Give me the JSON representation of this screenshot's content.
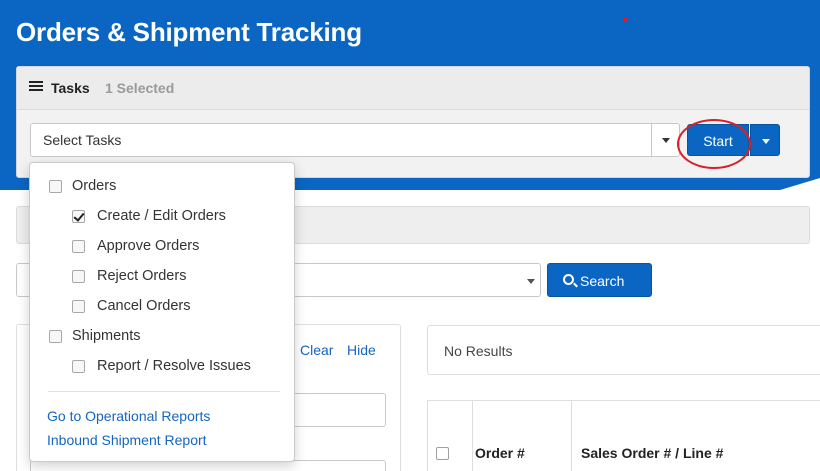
{
  "page": {
    "title": "Orders & Shipment Tracking"
  },
  "tasks": {
    "label": "Tasks",
    "selected_count": "1 Selected",
    "select_value": "Select Tasks",
    "start_label": "Start"
  },
  "search": {
    "label": "Search"
  },
  "side": {
    "clear_label": "Clear",
    "hide_label": "Hide"
  },
  "results": {
    "status": "No Results",
    "columns": [
      "Order #",
      "Sales Order # / Line #"
    ]
  },
  "dropdown": {
    "items": [
      {
        "label": "Orders",
        "checked": false,
        "level": 0
      },
      {
        "label": "Create / Edit Orders",
        "checked": true,
        "level": 1
      },
      {
        "label": "Approve Orders",
        "checked": false,
        "level": 1
      },
      {
        "label": "Reject Orders",
        "checked": false,
        "level": 1
      },
      {
        "label": "Cancel Orders",
        "checked": false,
        "level": 1
      },
      {
        "label": "Shipments",
        "checked": false,
        "level": 0
      },
      {
        "label": "Report / Resolve Issues",
        "checked": false,
        "level": 1
      }
    ],
    "links": [
      "Go to Operational Reports",
      "Inbound Shipment Report"
    ]
  },
  "colors": {
    "brand_blue": "#0a66c2",
    "link_blue": "#1565c0",
    "highlight_red": "#d8202a"
  }
}
